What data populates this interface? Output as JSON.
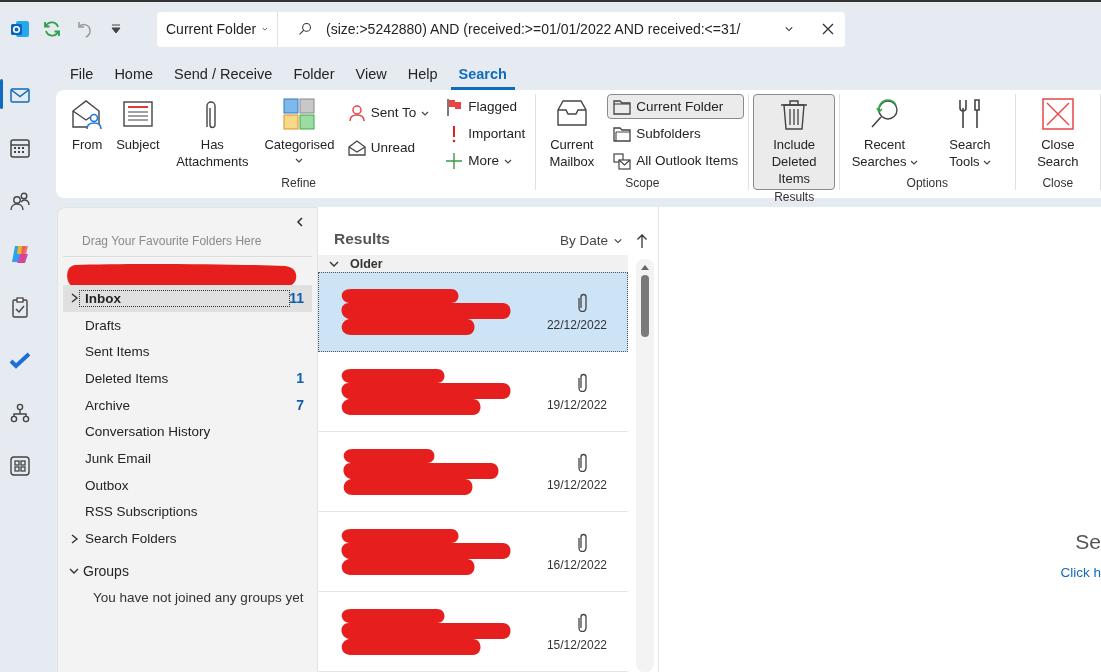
{
  "search": {
    "scope": "Current Folder",
    "query": "(size:>5242880) AND (received:>=01/01/2022 AND received:<=31/"
  },
  "nav_rail": [
    {
      "kind": "mail",
      "selected": true
    },
    {
      "kind": "calendar",
      "selected": false
    },
    {
      "kind": "people",
      "selected": false
    },
    {
      "kind": "copilot",
      "selected": false
    },
    {
      "kind": "tasks",
      "selected": false
    },
    {
      "kind": "todo",
      "selected": false
    },
    {
      "kind": "org",
      "selected": false
    },
    {
      "kind": "apps",
      "selected": false
    }
  ],
  "tabs": [
    {
      "label": "File",
      "selected": false
    },
    {
      "label": "Home",
      "selected": false
    },
    {
      "label": "Send / Receive",
      "selected": false
    },
    {
      "label": "Folder",
      "selected": false
    },
    {
      "label": "View",
      "selected": false
    },
    {
      "label": "Help",
      "selected": false
    },
    {
      "label": "Search",
      "selected": true
    }
  ],
  "ribbon": [
    {
      "label": "Refine",
      "items": [
        {
          "kind": "large",
          "label": "From",
          "dropdown": false,
          "selected": false
        },
        {
          "kind": "large",
          "label": "Subject",
          "dropdown": false,
          "selected": false
        },
        {
          "kind": "large",
          "label": "Has Attachments",
          "dropdown": false,
          "selected": false
        },
        {
          "kind": "large",
          "label": "Categorised",
          "dropdown": true,
          "selected": false
        },
        {
          "kind": "small",
          "label": "Sent To",
          "dropdown": true,
          "selected": false
        },
        {
          "kind": "small",
          "label": "Unread",
          "dropdown": false,
          "selected": false
        },
        {
          "kind": "small",
          "label": "Flagged",
          "dropdown": false,
          "selected": false
        },
        {
          "kind": "small",
          "label": "Important",
          "dropdown": false,
          "selected": false
        },
        {
          "kind": "small",
          "label": "More",
          "dropdown": true,
          "selected": false
        }
      ]
    },
    {
      "label": "Scope",
      "items": [
        {
          "kind": "large",
          "label": "Current Mailbox",
          "dropdown": false,
          "selected": false
        },
        {
          "kind": "small",
          "label": "Current Folder",
          "dropdown": false,
          "selected": true
        },
        {
          "kind": "small",
          "label": "Subfolders",
          "dropdown": false,
          "selected": false
        },
        {
          "kind": "small",
          "label": "All Outlook Items",
          "dropdown": false,
          "selected": false
        }
      ]
    },
    {
      "label": "Results",
      "items": [
        {
          "kind": "large",
          "label": "Include Deleted Items",
          "dropdown": false,
          "selected": true
        }
      ]
    },
    {
      "label": "Options",
      "items": [
        {
          "kind": "large",
          "label": "Recent Searches",
          "dropdown": true,
          "selected": false
        },
        {
          "kind": "large",
          "label": "Search Tools",
          "dropdown": true,
          "selected": false
        }
      ]
    },
    {
      "label": "Close",
      "items": [
        {
          "kind": "large",
          "label": "Close Search",
          "dropdown": false,
          "selected": false
        }
      ]
    }
  ],
  "folder_pane": {
    "hint": "Drag Your Favourite Folders Here",
    "account": {
      "redacted": true
    },
    "folders": [
      {
        "label": "Inbox",
        "count": "11",
        "selected": true,
        "expandable": true
      },
      {
        "label": "Drafts",
        "selected": false,
        "expandable": false
      },
      {
        "label": "Sent Items",
        "selected": false,
        "expandable": false
      },
      {
        "label": "Deleted Items",
        "count": "1",
        "selected": false,
        "expandable": false
      },
      {
        "label": "Archive",
        "count": "7",
        "selected": false,
        "expandable": false
      },
      {
        "label": "Conversation History",
        "selected": false,
        "expandable": false
      },
      {
        "label": "Junk Email",
        "selected": false,
        "expandable": false
      },
      {
        "label": "Outbox",
        "selected": false,
        "expandable": false
      },
      {
        "label": "RSS Subscriptions",
        "selected": false,
        "expandable": false
      },
      {
        "label": "Search Folders",
        "selected": false,
        "expandable": true
      }
    ],
    "groups": {
      "label": "Groups",
      "expanded": true,
      "message": "You have not joined any groups yet"
    }
  },
  "message_list": {
    "title": "Results",
    "sort": "By Date",
    "group": {
      "label": "Older",
      "expanded": true
    },
    "messages": [
      {
        "redacted": true,
        "attachment": true,
        "date": "22/12/2022",
        "selected": true
      },
      {
        "redacted": true,
        "attachment": true,
        "date": "19/12/2022",
        "selected": false
      },
      {
        "redacted": true,
        "attachment": true,
        "date": "19/12/2022",
        "selected": false
      },
      {
        "redacted": true,
        "attachment": true,
        "date": "16/12/2022",
        "selected": false
      },
      {
        "redacted": true,
        "attachment": true,
        "date": "15/12/2022",
        "selected": false
      }
    ]
  },
  "reading_pane": {
    "title": "Se",
    "link": "Click h"
  }
}
